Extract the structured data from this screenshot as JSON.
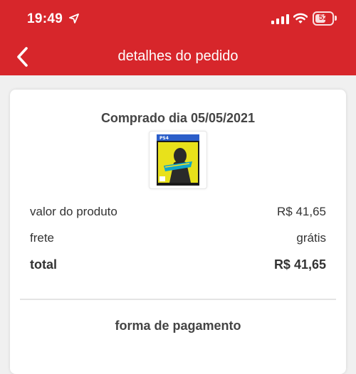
{
  "status_bar": {
    "time": "19:49",
    "battery": "52",
    "icons": [
      "location-arrow-icon",
      "cellular-signal-icon",
      "wifi-icon",
      "battery-icon"
    ]
  },
  "header": {
    "title": "detalhes do pedido",
    "back_icon": "chevron-left-icon",
    "background": "#d7262b"
  },
  "order": {
    "purchase_date": "Comprado dia 05/05/2021",
    "product_image": "cyberpunk-2077-ps4-cover",
    "summary": [
      {
        "label": "valor do produto",
        "value": "R$ 41,65"
      },
      {
        "label": "frete",
        "value": "grátis"
      }
    ],
    "total": {
      "label": "total",
      "value": "R$ 41,65"
    }
  },
  "payment": {
    "section_title": "forma de pagamento"
  }
}
